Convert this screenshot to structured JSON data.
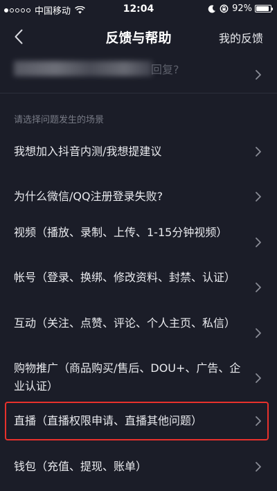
{
  "status_bar": {
    "carrier": "中国移动",
    "time": "12:04",
    "battery": "92%",
    "battery_level": 0.92
  },
  "nav": {
    "title": "反馈与帮助",
    "action": "我的反馈"
  },
  "top_item": {
    "visible_tail": "回复?"
  },
  "section_title": "请选择问题发生的场景",
  "items": [
    {
      "label": "我想加入抖音内测/我想提建议"
    },
    {
      "label": "为什么微信/QQ注册登录失败?"
    },
    {
      "label": "视频（播放、录制、上传、1-15分钟视频）"
    },
    {
      "label": "帐号（登录、换绑、修改资料、封禁、认证）"
    },
    {
      "label": "互动（关注、点赞、评论、个人主页、私信）"
    },
    {
      "label": "购物推广（商品购买/售后、DOU+、广告、企业认证）"
    },
    {
      "label": "直播（直播权限申请、直播其他问题）"
    },
    {
      "label": "钱包（充值、提现、账单）"
    }
  ],
  "colors": {
    "background": "#1b1d28",
    "highlight": "#e8312c"
  }
}
